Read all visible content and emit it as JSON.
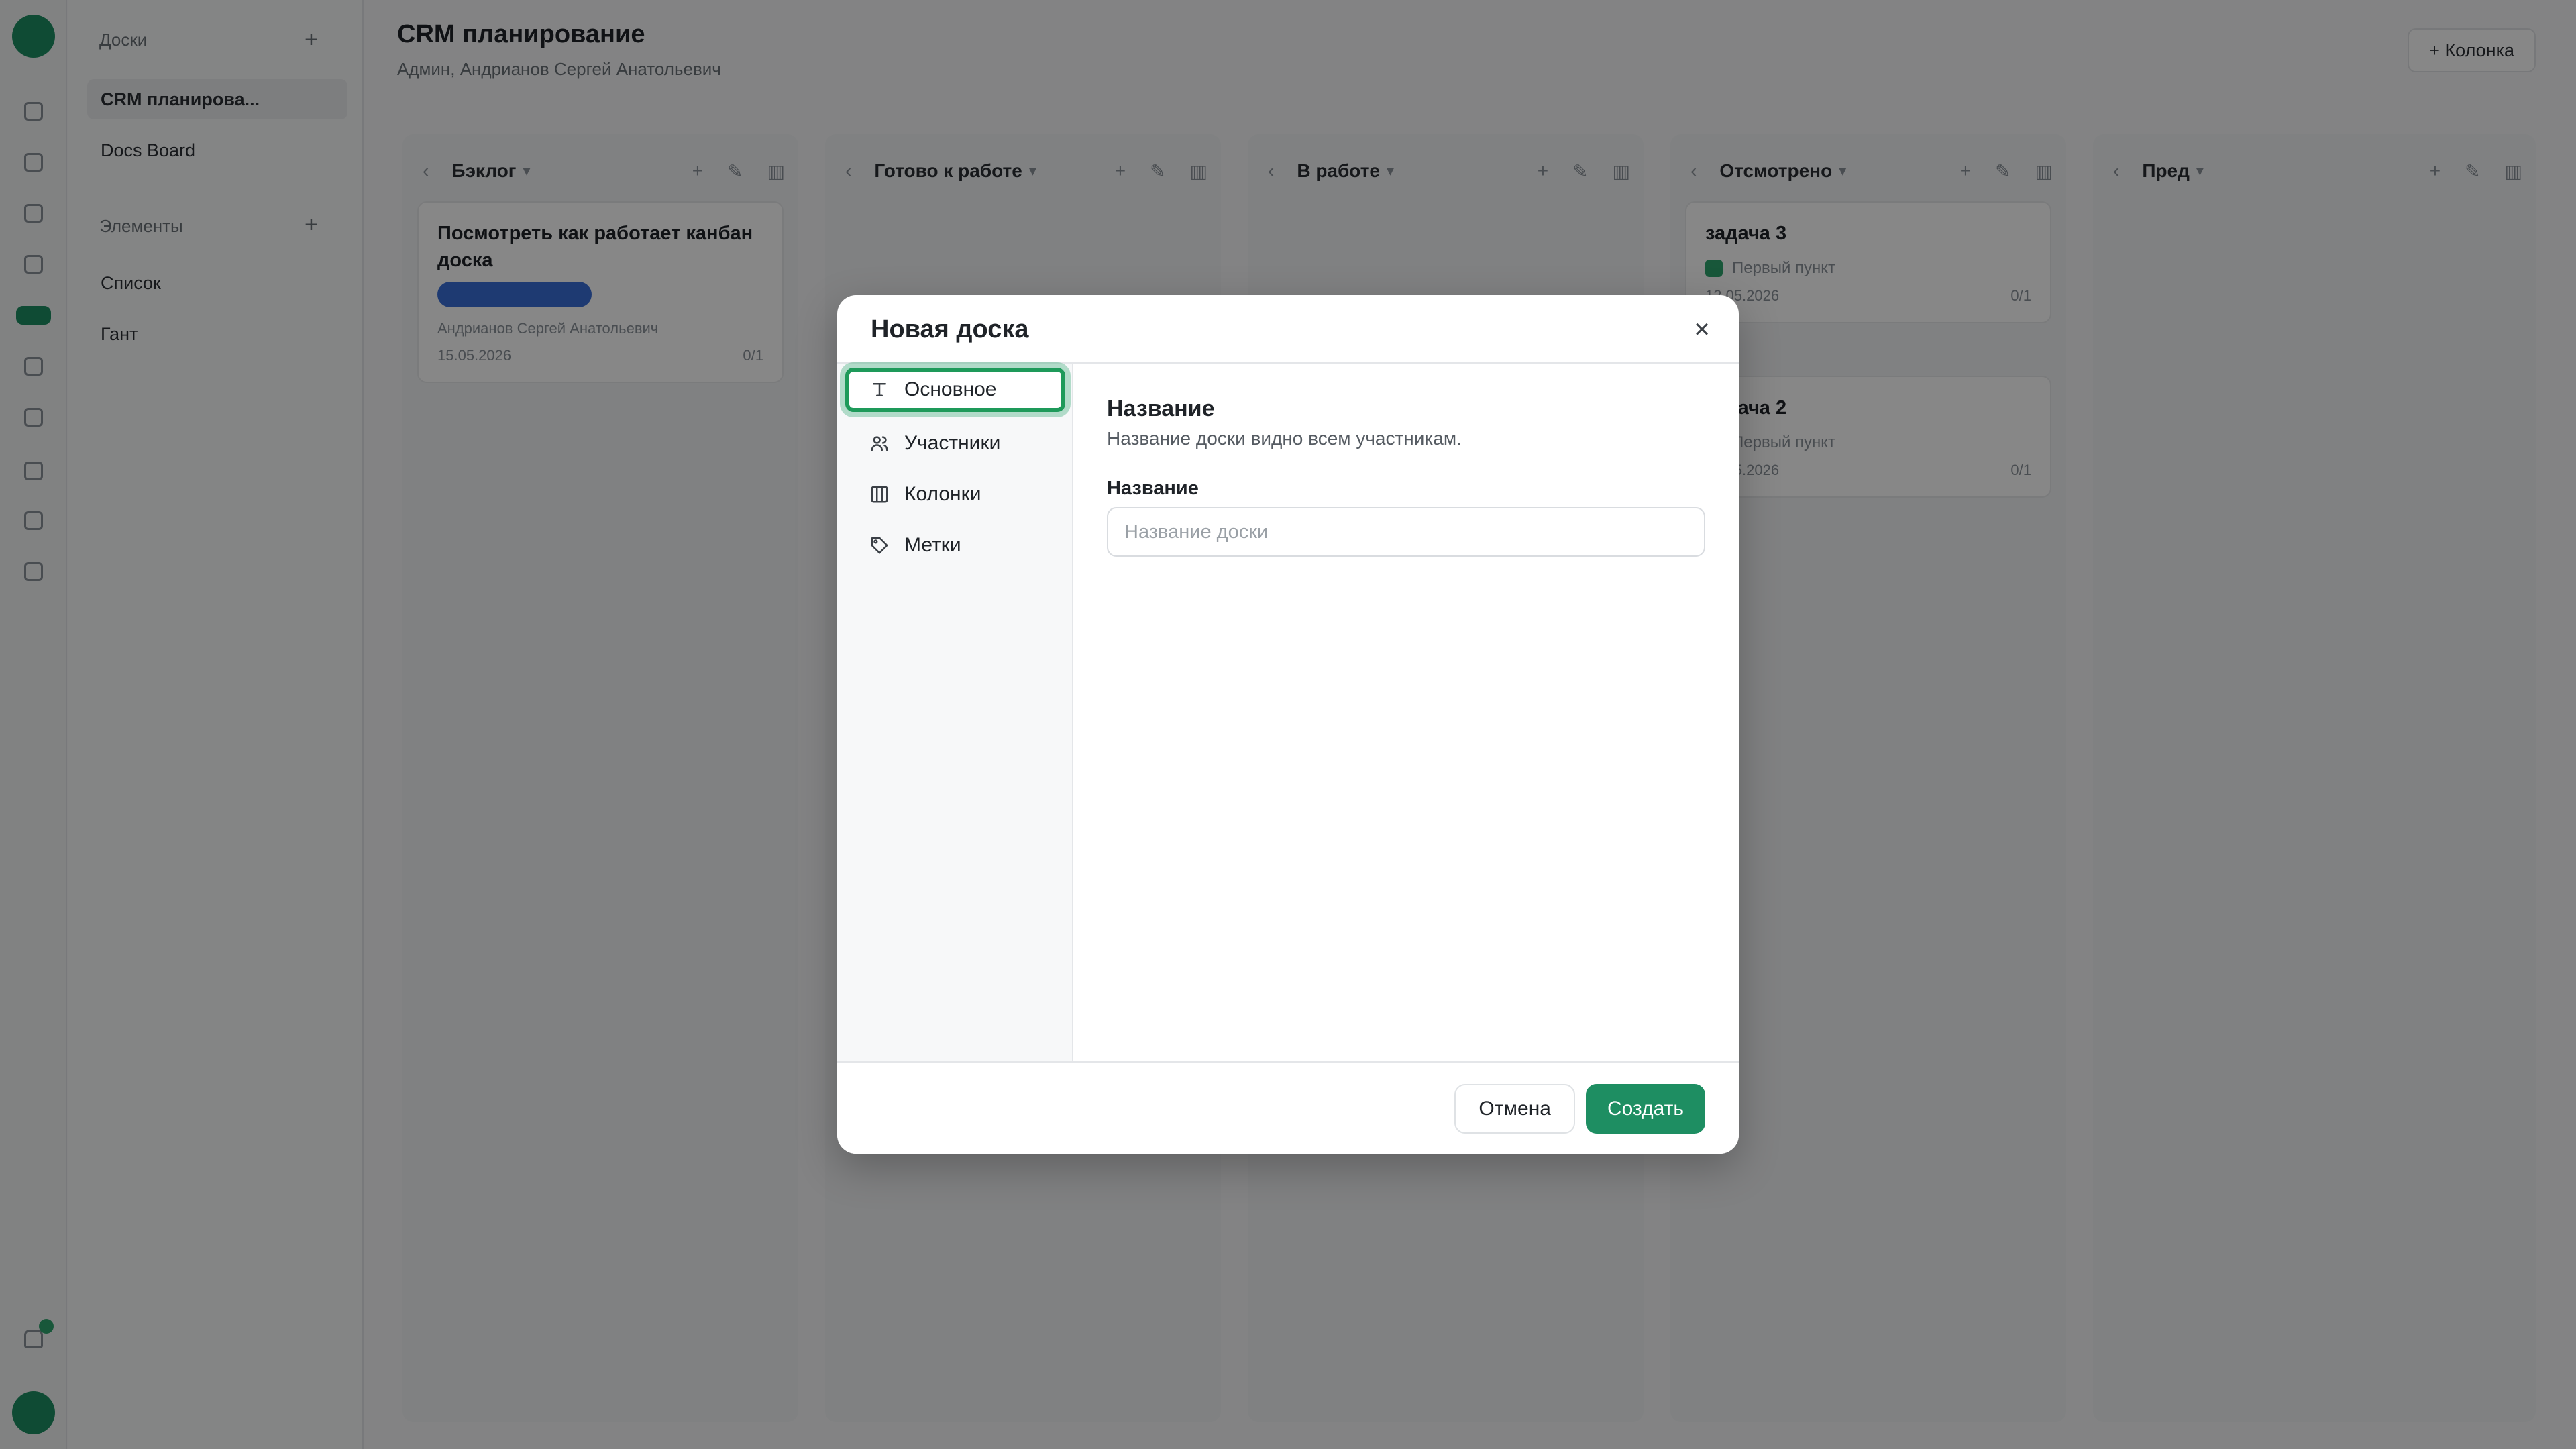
{
  "app": {
    "sidebar": {
      "boards_group": "Доски",
      "boards": [
        "CRM планирова...",
        "Docs Board"
      ],
      "elements_group": "Элементы",
      "elements": [
        "Список",
        "Гант"
      ]
    },
    "header": {
      "title": "CRM планирование",
      "subtitle": "Админ, Андрианов Сергей Анатольевич",
      "action": "Колонка"
    },
    "columns": [
      {
        "name": "Бэклог"
      },
      {
        "name": "Готово к работе"
      },
      {
        "name": "В работе"
      },
      {
        "name": "Отсмотрено"
      },
      {
        "name": "Пред"
      }
    ],
    "cards": [
      {
        "title": "Посмотреть как работает канбан доска",
        "author": "Андрианов Сергей Анатольевич",
        "date": "15.05.2026",
        "count": "0/1"
      },
      {
        "title": "задача 3",
        "note": "Первый пункт",
        "date": "12.05.2026",
        "count": "0/1"
      },
      {
        "title": "задача 2",
        "note": "Первый пункт",
        "date": "12.05.2026",
        "count": "0/1"
      }
    ]
  },
  "modal": {
    "title": "Новая доска",
    "close_icon": "×",
    "nav": [
      {
        "label": "Основное",
        "icon": "text-icon"
      },
      {
        "label": "Участники",
        "icon": "users-icon"
      },
      {
        "label": "Колонки",
        "icon": "columns-icon"
      },
      {
        "label": "Метки",
        "icon": "tag-icon"
      }
    ],
    "section_title": "Название",
    "section_desc": "Название доски видно всем участникам.",
    "field_label": "Название",
    "field_placeholder": "Название доски",
    "field_value": "",
    "cancel_label": "Отмена",
    "create_label": "Создать"
  },
  "colors": {
    "accent": "#1e8e62",
    "active_outline": "#1e9a5a",
    "overlay": "rgba(0,0,0,0.47)"
  }
}
